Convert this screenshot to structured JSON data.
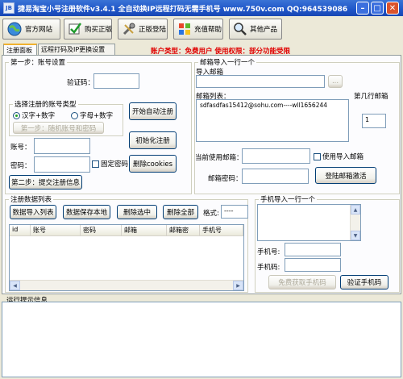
{
  "window": {
    "icon_text": "JB",
    "title": "捷易淘宝小号注册软件v3.4.1    全自动换IP远程打码无需手机号 www.750v.com  QQ:964539086",
    "minimize": "–",
    "maximize": "□",
    "close": "✕"
  },
  "toolbar": {
    "official_site": "官方网站",
    "buy_full": "购买正版",
    "login_full": "正版登陆",
    "recharge_help": "充值帮助",
    "other_products": "其他产品"
  },
  "account_info": "账户类型：免费用户    使用权限：部分功能受限",
  "tabs": [
    "注册面板",
    "远程打码及IP更换设置"
  ],
  "step1": {
    "legend": "第一步：账号设置",
    "captcha_label": "验证码：",
    "captcha_value": "",
    "type_legend": "选择注册的账号类型",
    "radio_cn_digit": "汉字+数字",
    "radio_letter_digit": "字母+数字",
    "random_btn": "第一步：随机账号和密码",
    "account_label": "账号：",
    "account_value": "",
    "password_label": "密码：",
    "password_value": "",
    "fixed_password": "固定密码",
    "start_auto_btn": "开始自动注册",
    "init_btn": "初始化注册",
    "delete_cookies_btn": "删除cookies",
    "submit_btn": "第二步：提交注册信息"
  },
  "email": {
    "legend": "邮箱导入一行一个",
    "import_label": "导入邮箱",
    "import_value": "",
    "browse_btn": "...",
    "list_label": "邮箱列表：",
    "list_text": "sdfasdfas15412@sohu.com----wll1656244",
    "row_label": "第几行邮箱",
    "row_value": "1",
    "current_label": "当前使用邮箱：",
    "current_value": "",
    "use_import_label": "使用导入邮箱",
    "password_label": "邮箱密码：",
    "password_value": "",
    "login_activate_btn": "登陆邮箱激活"
  },
  "reg_list": {
    "legend": "注册数据列表",
    "import_btn": "数据导入列表",
    "save_btn": "数据保存本地",
    "delete_selected_btn": "删除选中",
    "delete_all_btn": "删除全部",
    "format_label": "格式:",
    "format_value": "----",
    "columns": [
      "id",
      "账号",
      "密码",
      "邮箱",
      "邮箱密",
      "手机号"
    ]
  },
  "phone": {
    "legend": "手机导入一行一个",
    "phone_label": "手机号:",
    "phone_value": "",
    "code_label": "手机码:",
    "code_value": "",
    "free_code_btn": "免费获取手机码",
    "verify_btn": "验证手机码"
  },
  "log": {
    "label": "运行提示信息",
    "text": ""
  }
}
